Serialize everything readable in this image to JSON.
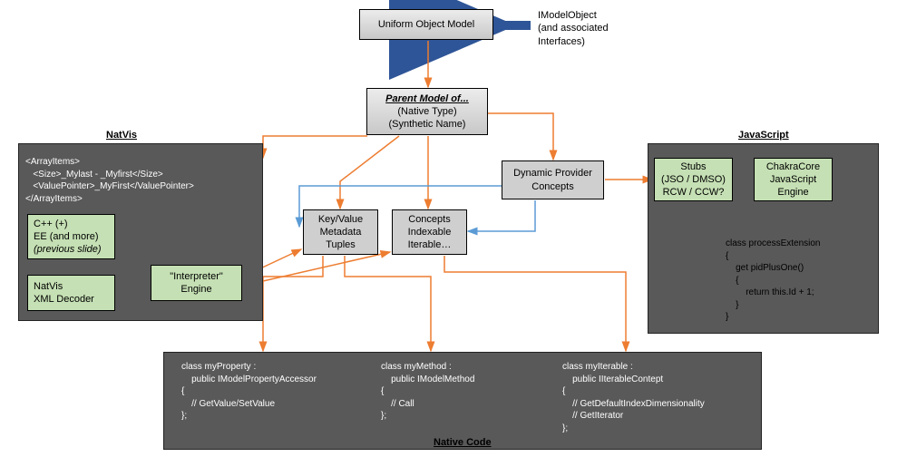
{
  "top": {
    "uniform_object_model": "Uniform Object Model",
    "imodelobject_l1": "IModelObject",
    "imodelobject_l2": "(and associated",
    "imodelobject_l3": "Interfaces)"
  },
  "parent_model": {
    "title": "Parent Model of...",
    "line2": "(Native Type)",
    "line3": "(Synthetic Name)"
  },
  "center": {
    "dynamic_provider_l1": "Dynamic Provider",
    "dynamic_provider_l2": "Concepts",
    "kv_l1": "Key/Value",
    "kv_l2": "Metadata",
    "kv_l3": "Tuples",
    "concepts_l1": "Concepts",
    "concepts_l2": "Indexable",
    "concepts_l3": "Iterable…"
  },
  "natvis": {
    "panel_title": "NatVis",
    "code_l1": "<ArrayItems>",
    "code_l2": "   <Size>_Mylast - _Myfirst</Size>",
    "code_l3": "   <ValuePointer>_MyFirst</ValuePointer>",
    "code_l4": "</ArrayItems>",
    "cpp_l1": "C++ (+)",
    "cpp_l2": "EE (and more)",
    "cpp_l3": "(previous slide)",
    "decoder_l1": "NatVis",
    "decoder_l2": "XML Decoder",
    "interp_l1": "\"Interpreter\"",
    "interp_l2": "Engine"
  },
  "js": {
    "panel_title": "JavaScript",
    "stubs_l1": "Stubs",
    "stubs_l2": "(JSO / DMSO)",
    "stubs_l3": "RCW / CCW?",
    "chakra_l1": "ChakraCore",
    "chakra_l2": "JavaScript",
    "chakra_l3": "Engine",
    "code_l1": "class processExtension",
    "code_l2": "{",
    "code_l3": "    get pidPlusOne()",
    "code_l4": "    {",
    "code_l5": "        return this.Id + 1;",
    "code_l6": "    }",
    "code_l7": "}"
  },
  "native": {
    "panel_title": "Native Code",
    "prop_l1": "class myProperty :",
    "prop_l2": "    public IModelPropertyAccessor",
    "prop_l3": "{",
    "prop_l4": "    // GetValue/SetValue",
    "prop_l5": "};",
    "method_l1": "class myMethod :",
    "method_l2": "    public IModelMethod",
    "method_l3": "{",
    "method_l4": "    // Call",
    "method_l5": "};",
    "iter_l1": "class myIterable :",
    "iter_l2": "    public IIterableContept",
    "iter_l3": "{",
    "iter_l4": "    // GetDefaultIndexDimensionality",
    "iter_l5": "    // GetIterator",
    "iter_l6": "};"
  }
}
